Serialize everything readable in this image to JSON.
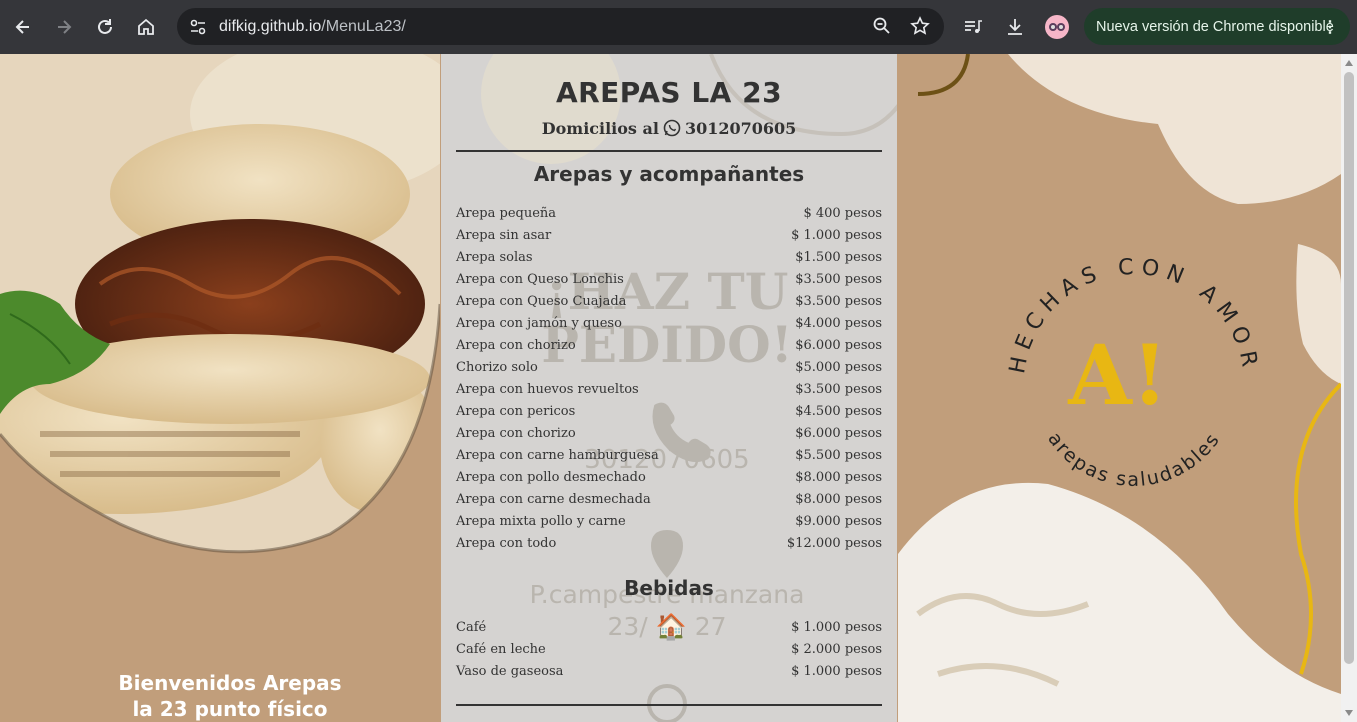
{
  "browser": {
    "url_host": "difkig.github.io",
    "url_path": "/MenuLa23/",
    "update_label": "Nueva versión de Chrome disponible"
  },
  "menu": {
    "title": "AREPAS LA 23",
    "delivery_prefix": "Domicilios al",
    "phone": "3012070605",
    "sections": [
      {
        "title": "Arepas y acompañantes",
        "items": [
          {
            "name": "Arepa pequeña",
            "price": "$ 400 pesos"
          },
          {
            "name": "Arepa sin asar",
            "price": "$ 1.000 pesos"
          },
          {
            "name": "Arepa solas",
            "price": "$1.500 pesos"
          },
          {
            "name": "Arepa con Queso Lonchis",
            "price": "$3.500 pesos"
          },
          {
            "name": "Arepa con Queso Cuajada",
            "price": "$3.500 pesos"
          },
          {
            "name": "Arepa con jamón y queso",
            "price": "$4.000 pesos"
          },
          {
            "name": "Arepa con chorizo",
            "price": "$6.000 pesos"
          },
          {
            "name": "Chorizo solo",
            "price": "$5.000 pesos"
          },
          {
            "name": "Arepa con huevos revueltos",
            "price": "$3.500 pesos"
          },
          {
            "name": "Arepa con pericos",
            "price": "$4.500 pesos"
          },
          {
            "name": "Arepa con chorizo",
            "price": "$6.000 pesos"
          },
          {
            "name": "Arepa con carne hamburguesa",
            "price": "$5.500 pesos"
          },
          {
            "name": "Arepa con pollo desmechado",
            "price": "$8.000 pesos"
          },
          {
            "name": "Arepa con carne desmechada",
            "price": "$8.000 pesos"
          },
          {
            "name": "Arepa mixta pollo y carne",
            "price": "$9.000 pesos"
          },
          {
            "name": "Arepa con todo",
            "price": "$12.000 pesos"
          }
        ]
      },
      {
        "title": "Bebidas",
        "items": [
          {
            "name": "Café",
            "price": "$ 1.000 pesos"
          },
          {
            "name": "Café en leche",
            "price": "$ 2.000 pesos"
          },
          {
            "name": "Vaso de gaseosa",
            "price": "$ 1.000 pesos"
          }
        ]
      }
    ]
  },
  "background": {
    "welcome_line1": "Bienvenidos Arepas",
    "welcome_line2": "la 23 punto físico",
    "watermark_line1": "¡HAZ TU",
    "watermark_line2": "PEDIDO!",
    "watermark_phone": "3012070605",
    "watermark_address_1": "P.campestre manzana",
    "watermark_address_2": "23/ 🏠 27",
    "badge_arc_top": "HECHAS CON AMOR",
    "badge_arc_bottom": "arepas saludables",
    "badge_logo": "A!"
  },
  "colors": {
    "page_bg": "#c19e7b",
    "panel_bg": "#d6d6d6",
    "logo_yellow": "#e8b713"
  }
}
